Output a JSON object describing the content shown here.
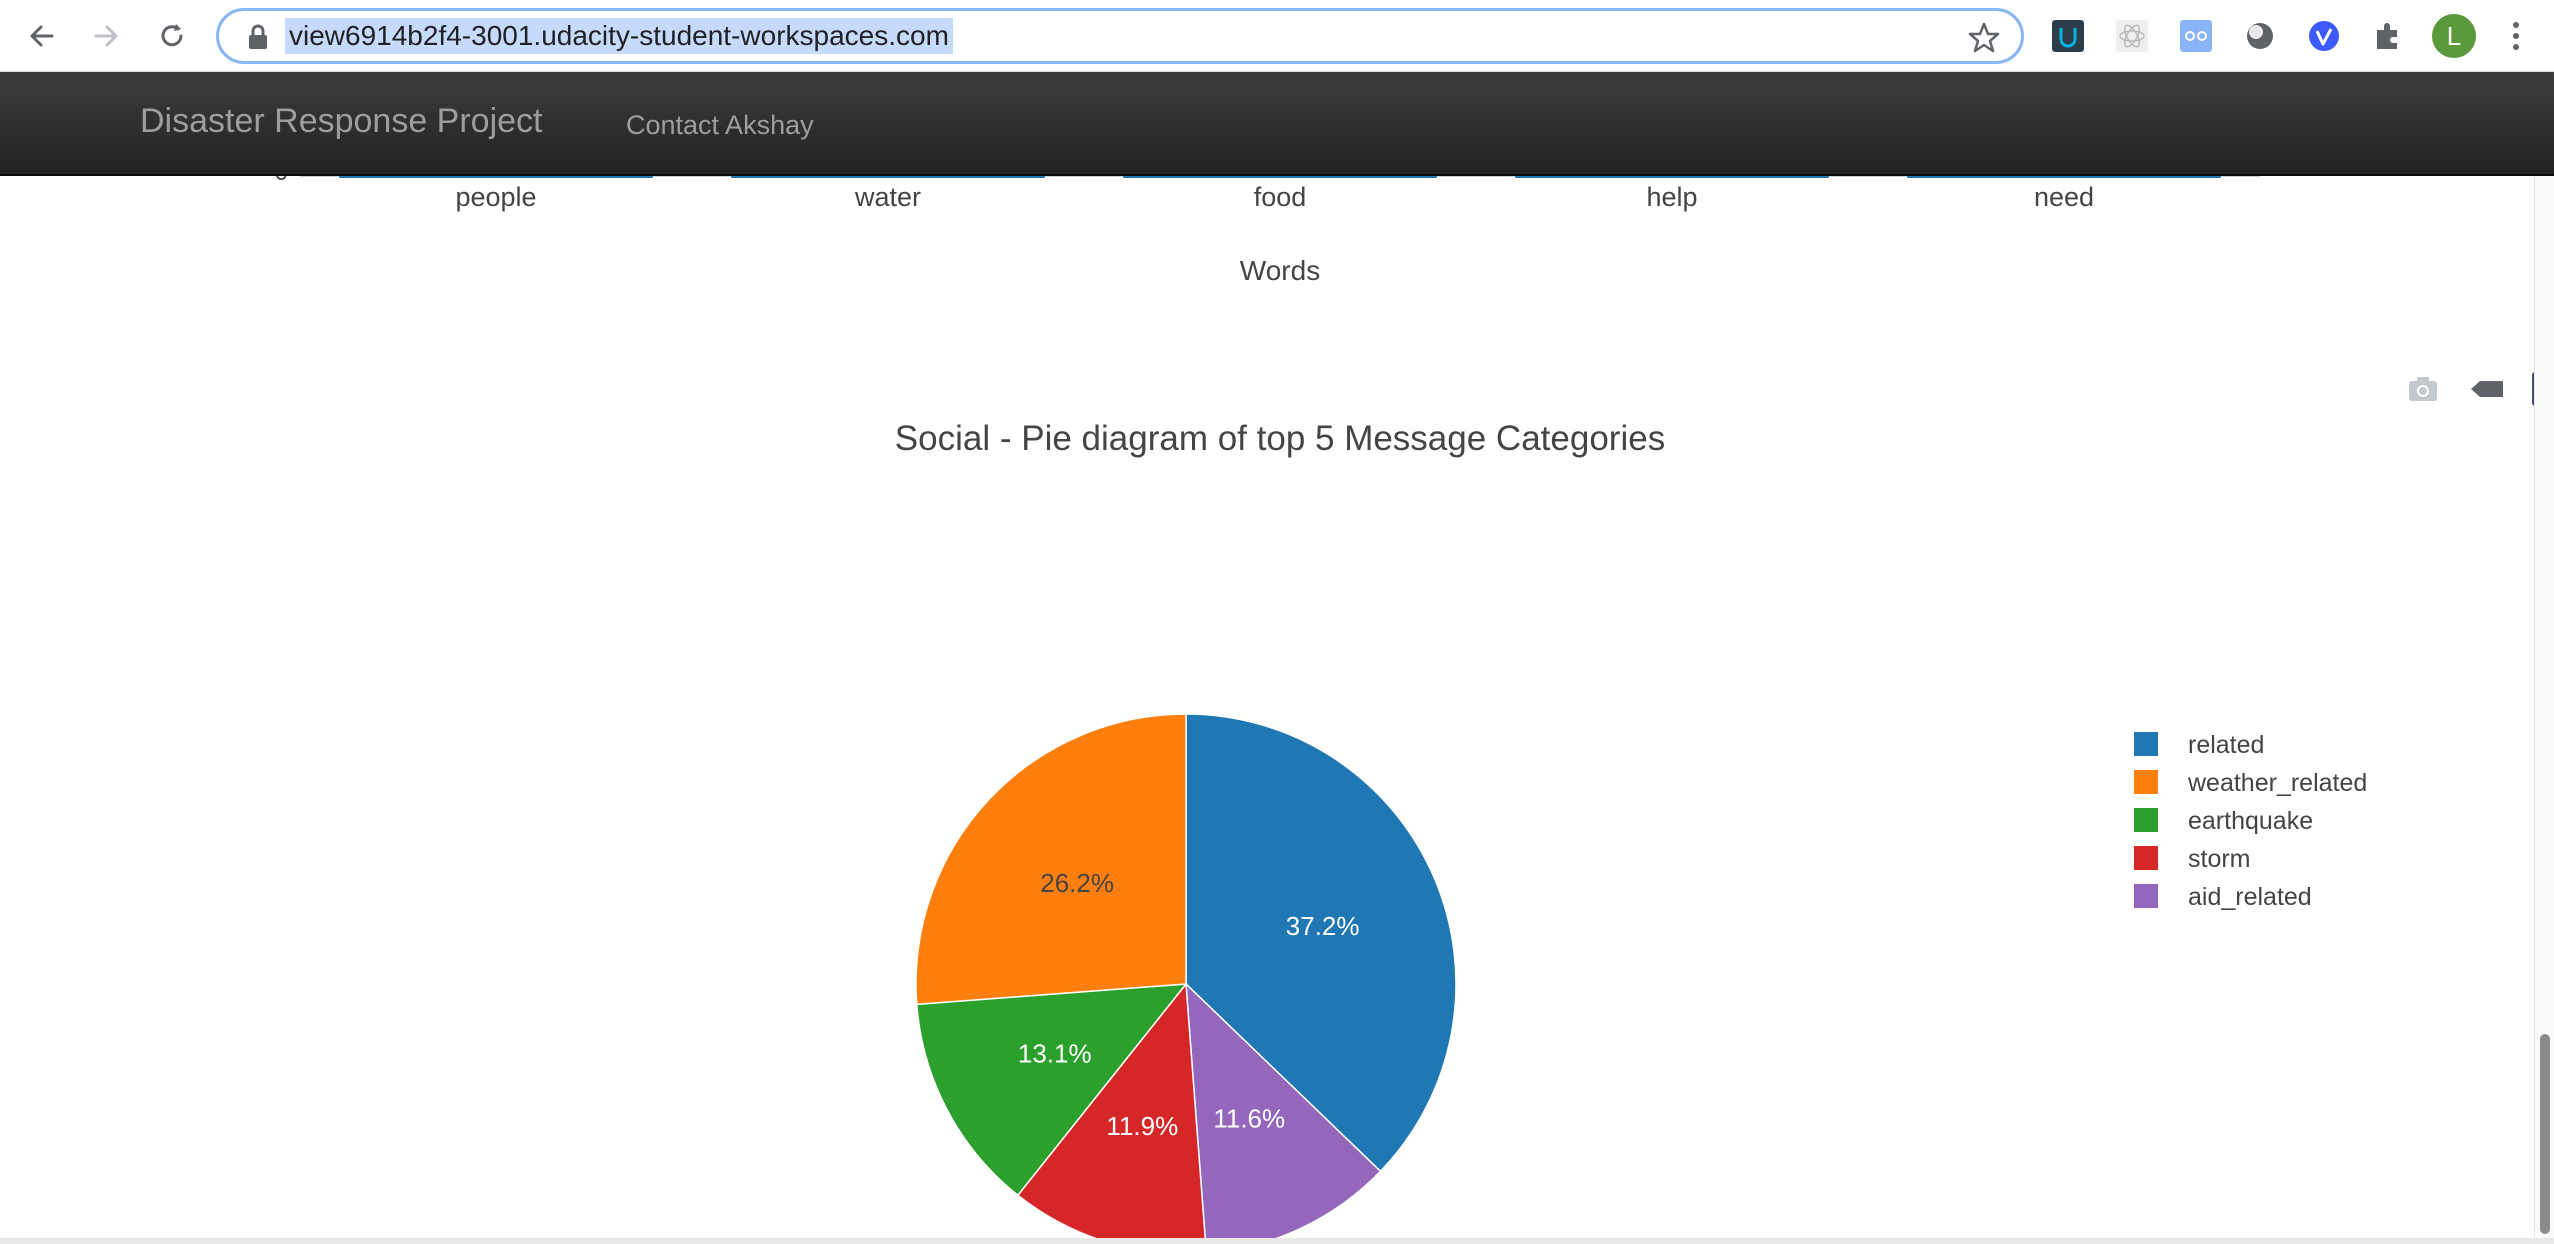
{
  "browser": {
    "url": "view6914b2f4-3001.udacity-student-workspaces.com",
    "profile_initial": "L"
  },
  "navbar": {
    "brand": "Disaster Response Project",
    "contact_link": "Contact Akshay"
  },
  "word_chart": {
    "chart_data": {
      "type": "bar",
      "categories": [
        "people",
        "water",
        "food",
        "help",
        "need"
      ],
      "xlabel": "Words",
      "ytick_visible": "0"
    }
  },
  "pie_chart": {
    "modebar": [
      "camera-icon",
      "tag-icon",
      "plotly-logo-icon"
    ],
    "chart_data": {
      "type": "pie",
      "title": "Social - Pie diagram of top 5 Message Categories",
      "labels": [
        "related",
        "weather_related",
        "earthquake",
        "storm",
        "aid_related"
      ],
      "values": [
        37.2,
        26.2,
        13.1,
        11.9,
        11.6
      ],
      "text_labels": [
        "37.2%",
        "26.2%",
        "13.1%",
        "11.9%",
        "11.6%"
      ],
      "colors": [
        "#1f77b4",
        "#ff7f0e",
        "#2ca02c",
        "#d62728",
        "#9467bd"
      ],
      "slice_order": [
        "related",
        "aid_related",
        "storm",
        "earthquake",
        "weather_related"
      ],
      "direction": "clockwise",
      "legend_position": "top-right"
    }
  }
}
